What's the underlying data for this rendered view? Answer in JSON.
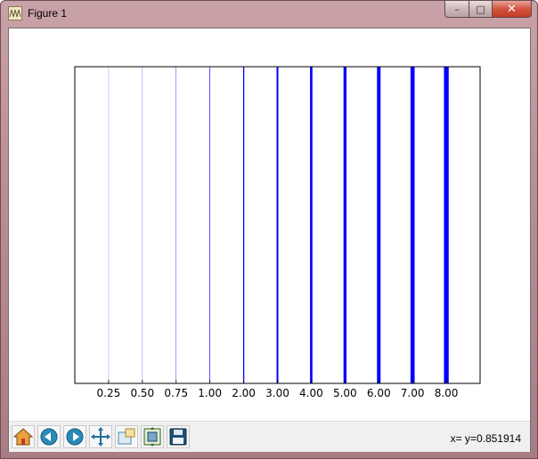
{
  "window": {
    "title": "Figure 1",
    "buttons": {
      "minimize": "–",
      "maximize": "□",
      "close": "✕"
    }
  },
  "chart_data": {
    "type": "line",
    "description_type": "vertical lines (axvline) of increasing width",
    "title": "",
    "xlabel": "",
    "ylabel": "",
    "x_tick_labels": [
      "0.25",
      "0.50",
      "0.75",
      "1.00",
      "2.00",
      "3.00",
      "4.00",
      "5.00",
      "6.00",
      "7.00",
      "8.00"
    ],
    "lines": [
      {
        "label": "0.25",
        "linewidth": 0.25,
        "color": "#0000ff"
      },
      {
        "label": "0.50",
        "linewidth": 0.5,
        "color": "#0000ff"
      },
      {
        "label": "0.75",
        "linewidth": 0.75,
        "color": "#0000ff"
      },
      {
        "label": "1.00",
        "linewidth": 1.0,
        "color": "#0000ff"
      },
      {
        "label": "2.00",
        "linewidth": 2.0,
        "color": "#0000ff"
      },
      {
        "label": "3.00",
        "linewidth": 3.0,
        "color": "#0000ff"
      },
      {
        "label": "4.00",
        "linewidth": 4.0,
        "color": "#0000ff"
      },
      {
        "label": "5.00",
        "linewidth": 5.0,
        "color": "#0000ff"
      },
      {
        "label": "6.00",
        "linewidth": 6.0,
        "color": "#0000ff"
      },
      {
        "label": "7.00",
        "linewidth": 7.0,
        "color": "#0000ff"
      },
      {
        "label": "8.00",
        "linewidth": 8.0,
        "color": "#0000ff"
      }
    ],
    "y_ticks": "none",
    "grid": false
  },
  "toolbar": {
    "tools": [
      {
        "name": "home-icon",
        "tooltip": "Home"
      },
      {
        "name": "back-arrow-icon",
        "tooltip": "Back"
      },
      {
        "name": "forward-arrow-icon",
        "tooltip": "Forward"
      },
      {
        "name": "pan-move-icon",
        "tooltip": "Pan"
      },
      {
        "name": "zoom-rect-icon",
        "tooltip": "Zoom"
      },
      {
        "name": "subplots-config-icon",
        "tooltip": "Subplots"
      },
      {
        "name": "save-floppy-icon",
        "tooltip": "Save"
      }
    ],
    "coord_readout": "x= y=0.851914"
  },
  "colors": {
    "line": "#0000ff",
    "axes_edge": "#000000",
    "toolbar_bg": "#f0f0f0",
    "window_frame": "#b98f96"
  }
}
